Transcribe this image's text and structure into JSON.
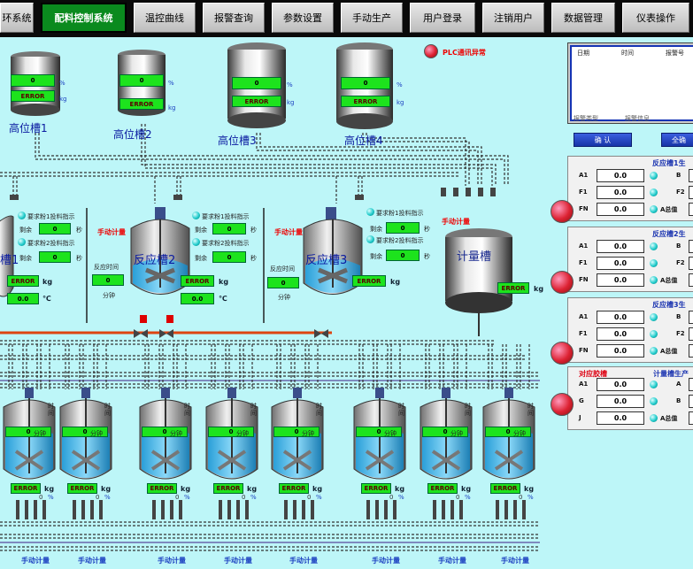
{
  "nav": {
    "tabs": [
      "环系统",
      "配料控制系统",
      "温控曲线",
      "报警查询",
      "参数设置",
      "手动生产",
      "用户登录",
      "注销用户",
      "数据管理",
      "仪表操作"
    ],
    "active": "配料控制系统"
  },
  "plc_alarm": "PLC通讯异常",
  "high_tanks": [
    {
      "name": "高位槽1",
      "value": "0",
      "status": "ERROR",
      "pct": "%",
      "unit": "kg"
    },
    {
      "name": "高位槽2",
      "value": "0",
      "status": "ERROR",
      "pct": "%",
      "unit": "kg"
    },
    {
      "name": "高位槽3",
      "value": "0",
      "status": "ERROR",
      "pct": "%",
      "unit": "kg"
    },
    {
      "name": "高位槽4",
      "value": "0",
      "status": "ERROR",
      "pct": "%",
      "unit": "kg"
    }
  ],
  "reactors": [
    {
      "name": "槽1",
      "manual": "",
      "weight_status": "ERROR",
      "weight_unit": "kg",
      "temp": "0.0",
      "temp_unit": "℃"
    },
    {
      "name": "反应槽2",
      "manual": "手动计量",
      "react_time_label": "反应时间",
      "react_time": "0",
      "react_time_unit": "分钟",
      "weight_status": "ERROR",
      "weight_unit": "kg",
      "temp": "0.0",
      "temp_unit": "℃"
    },
    {
      "name": "反应槽3",
      "manual": "手动计量",
      "react_time_label": "反应时间",
      "react_time": "0",
      "react_time_unit": "分钟",
      "weight_status": "ERROR",
      "weight_unit": "kg"
    }
  ],
  "feed_indicators": {
    "req1": "要求粉1投料指示",
    "req2": "要求粉2投料指示",
    "remain": "剩余",
    "value": "0",
    "sec": "秒"
  },
  "meter_tank": {
    "name": "计量槽",
    "manual": "手动计量",
    "status": "ERROR",
    "unit": "kg"
  },
  "small_tanks": {
    "value": "0",
    "time_unit": "分钟",
    "status": "ERROR",
    "unit": "kg",
    "pct_value": "0",
    "pct": "%",
    "side_text": "时间",
    "manual": "手动计量"
  },
  "alarm_table": {
    "headers": [
      "日期",
      "时间",
      "报警号"
    ],
    "footer": [
      "报警类型",
      "报警信息"
    ]
  },
  "buttons": {
    "confirm": "确  认",
    "all": "全确"
  },
  "panels": [
    {
      "title": "反应槽1生",
      "rows": [
        [
          "A1",
          "0.0"
        ],
        [
          "F1",
          "0.0"
        ],
        [
          "FN",
          "0.0"
        ]
      ],
      "right": [
        "B",
        "F2",
        "A总值"
      ]
    },
    {
      "title": "反应槽2生",
      "rows": [
        [
          "A1",
          "0.0"
        ],
        [
          "F1",
          "0.0"
        ],
        [
          "FN",
          "0.0"
        ]
      ],
      "right": [
        "B",
        "F2",
        "A总值"
      ]
    },
    {
      "title": "反应槽3生",
      "rows": [
        [
          "A1",
          "0.0"
        ],
        [
          "F1",
          "0.0"
        ],
        [
          "FN",
          "0.0"
        ]
      ],
      "right": [
        "B",
        "F2",
        "A总值"
      ]
    },
    {
      "title": "计量槽生产",
      "left_title": "对应胶槽",
      "rows": [
        [
          "A1",
          "0.0"
        ],
        [
          "G",
          "0.0"
        ],
        [
          "J",
          "0.0"
        ]
      ],
      "right": [
        "A",
        "B",
        "A总值"
      ]
    }
  ]
}
